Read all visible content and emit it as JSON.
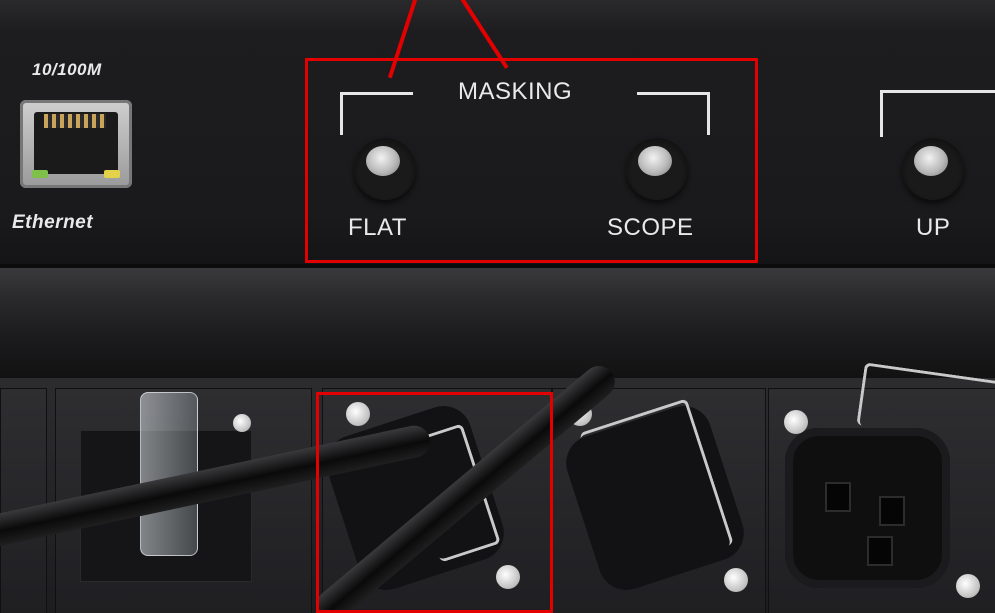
{
  "ethernet_port": {
    "speed_label": "10/100M",
    "name_label": "Ethernet"
  },
  "masking_group": {
    "title": "MASKING",
    "buttons": [
      {
        "label": "FLAT"
      },
      {
        "label": "SCOPE"
      }
    ]
  },
  "up_group": {
    "button_label": "UP"
  },
  "highlight": {
    "color": "#e30000"
  }
}
